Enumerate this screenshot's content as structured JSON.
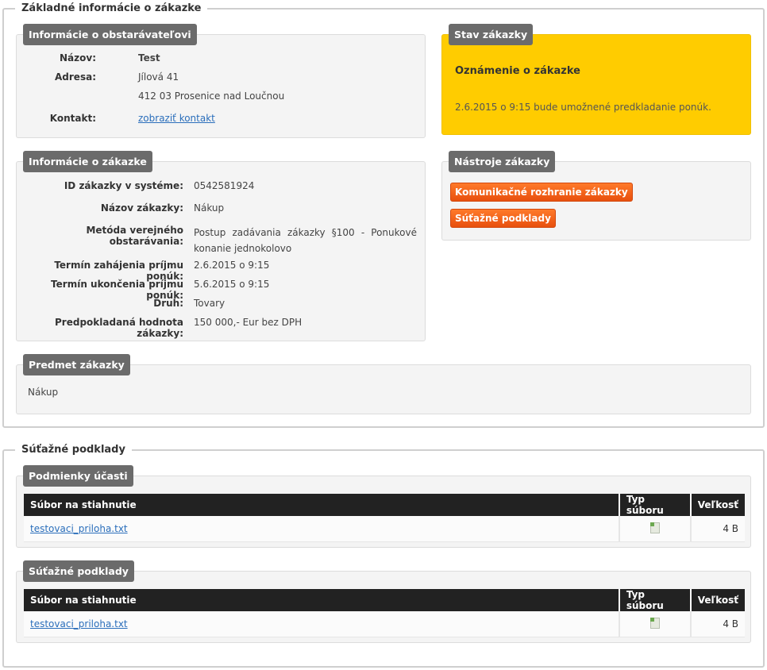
{
  "basic": {
    "legend": "Základné informácie o zákazke",
    "contracting": {
      "title": "Informácie o obstarávateľovi",
      "name_label": "Názov:",
      "name_value": "Test",
      "address_label": "Adresa:",
      "address_line1": "Jílová 41",
      "address_line2": "412 03 Prosenice nad Loučnou",
      "contact_label": "Kontakt:",
      "contact_link": "zobraziť kontakt"
    },
    "status": {
      "title": "Stav zákazky",
      "heading": "Oznámenie o zákazke",
      "text": "2.6.2015 o 9:15 bude umožnené predkladanie ponúk."
    },
    "contract_info": {
      "title": "Informácie o zákazke",
      "rows": [
        {
          "label": "ID zákazky v systéme:",
          "value": "0542581924"
        },
        {
          "label": "Názov zákazky:",
          "value": "Nákup"
        },
        {
          "label": "Metóda verejného obstarávania:",
          "value": "Postup zadávania zákazky §100 - Ponukové konanie jednokolovo"
        },
        {
          "label": "Termín zahájenia príjmu ponúk:",
          "value": "2.6.2015 o 9:15"
        },
        {
          "label": "Termín ukončenia príjmu ponúk:",
          "value": "5.6.2015 o 9:15"
        },
        {
          "label": "Druh:",
          "value": "Tovary"
        },
        {
          "label": "Predpokladaná hodnota zákazky:",
          "value": "150 000,- Eur bez DPH"
        }
      ]
    },
    "tools": {
      "title": "Nástroje zákazky",
      "btn_communication": "Komunikačné rozhranie zákazky",
      "btn_documents": "Súťažné podklady"
    },
    "subject": {
      "title": "Predmet zákazky",
      "text": "Nákup"
    }
  },
  "documents": {
    "legend": "Súťažné podklady",
    "header": {
      "file": "Súbor na stiahnutie",
      "type": "Typ súboru",
      "size": "Veľkosť"
    },
    "groups": [
      {
        "title": "Podmienky účasti",
        "file": "testovaci_priloha.txt",
        "icon": "text-file-icon",
        "size": "4 B"
      },
      {
        "title": "Súťažné podklady",
        "file": "testovaci_priloha.txt",
        "icon": "text-file-icon",
        "size": "4 B"
      }
    ]
  },
  "colors": {
    "status_bg": "#ffcc00",
    "button": "#f06018",
    "link": "#2a6ebb",
    "header_dark": "#222222"
  }
}
